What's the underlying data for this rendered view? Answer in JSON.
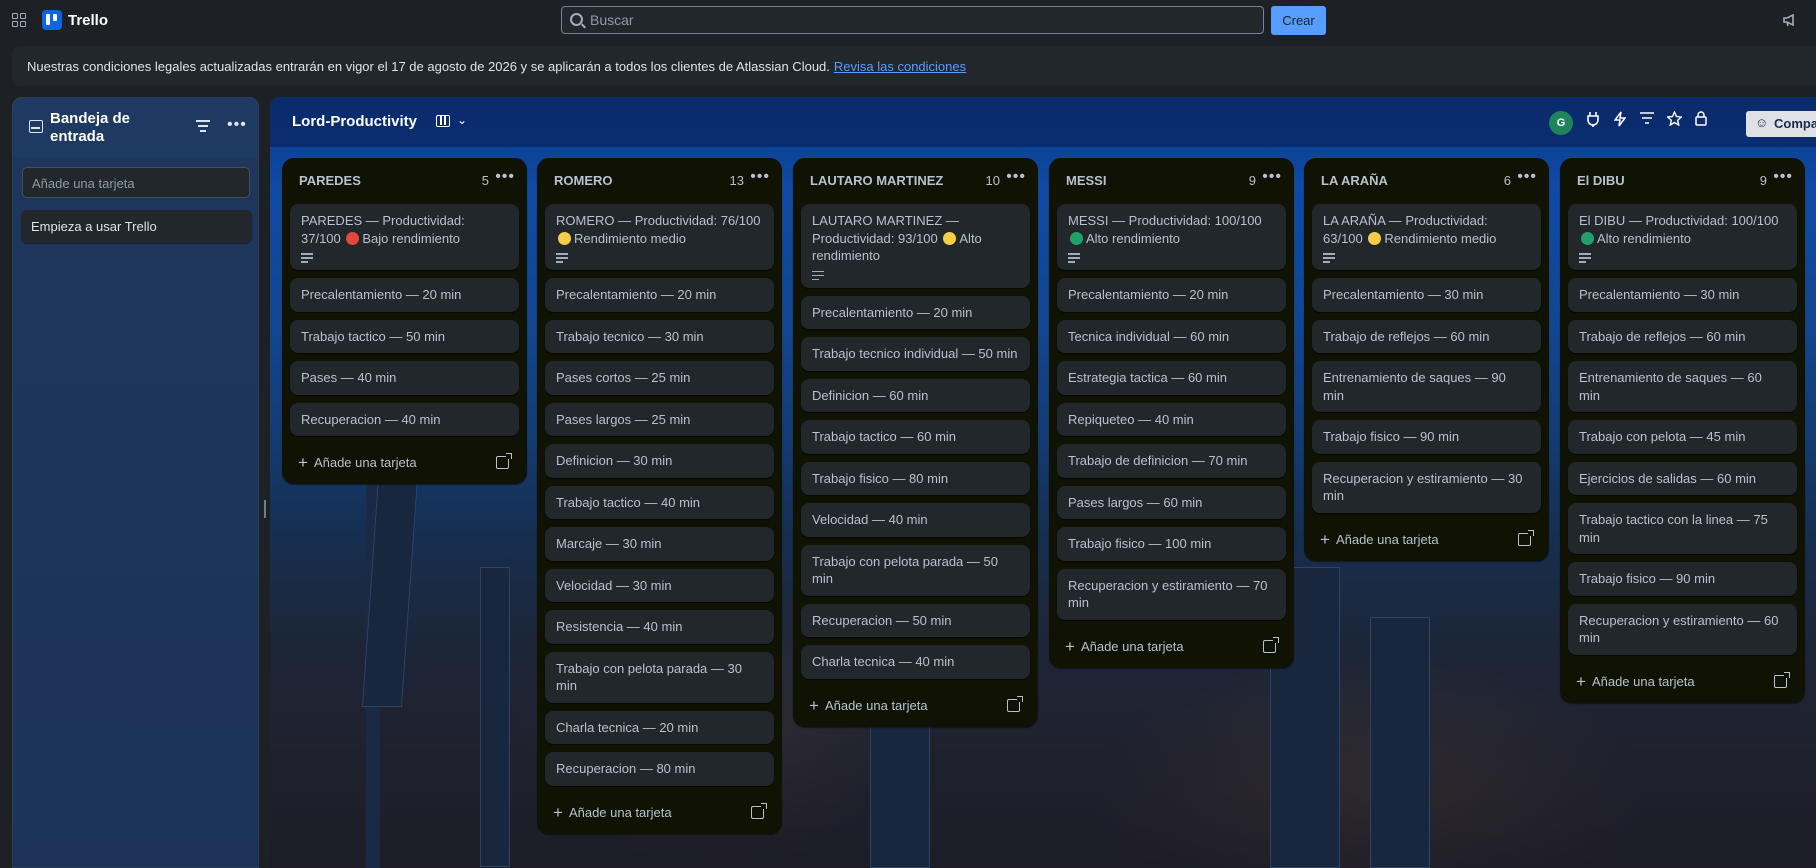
{
  "app": {
    "name": "Trello"
  },
  "search": {
    "placeholder": "Buscar"
  },
  "create_label": "Crear",
  "banner": {
    "text": "Nuestras condiciones legales actualizadas entrarán en vigor el 17 de agosto de 2026 y se aplicarán a todos los clientes de Atlassian Cloud.",
    "link": "Revisa las condiciones"
  },
  "inbox": {
    "title": "Bandeja de entrada",
    "add_placeholder": "Añade una tarjeta",
    "cards": [
      "Empieza a usar Trello"
    ]
  },
  "board": {
    "title": "Lord-Productivity",
    "member_initial": "G",
    "share_label": "Compa",
    "add_card_label": "Añade una tarjeta"
  },
  "status_colors": {
    "red": "#e2483d",
    "yellow": "#f5cd47",
    "green": "#22a06b"
  },
  "lists": [
    {
      "name": "PAREDES",
      "count": "5",
      "cards": [
        {
          "text": "PAREDES — Productividad: 37/100",
          "dot": "red",
          "status": "Bajo rendimiento",
          "desc": true
        },
        {
          "text": "Precalentamiento — 20 min"
        },
        {
          "text": "Trabajo tactico — 50 min"
        },
        {
          "text": "Pases — 40 min"
        },
        {
          "text": "Recuperacion — 40 min"
        }
      ]
    },
    {
      "name": "ROMERO",
      "count": "13",
      "cards": [
        {
          "text": "ROMERO — Productividad: 76/100",
          "dot": "yellow",
          "status": "Rendimiento medio",
          "desc": true
        },
        {
          "text": "Precalentamiento — 20 min"
        },
        {
          "text": "Trabajo tecnico — 30 min"
        },
        {
          "text": "Pases cortos — 25 min"
        },
        {
          "text": "Pases largos — 25 min"
        },
        {
          "text": "Definicion — 30 min"
        },
        {
          "text": "Trabajo tactico — 40 min"
        },
        {
          "text": "Marcaje — 30 min"
        },
        {
          "text": "Velocidad — 30 min"
        },
        {
          "text": "Resistencia — 40 min"
        },
        {
          "text": "Trabajo con pelota parada — 30 min"
        },
        {
          "text": "Charla tecnica — 20 min"
        },
        {
          "text": "Recuperacion — 80 min"
        }
      ]
    },
    {
      "name": "LAUTARO MARTINEZ",
      "count": "10",
      "cards": [
        {
          "text": "LAUTARO MARTINEZ — Productividad: 93/100",
          "dot": "yellow",
          "status": "Alto rendimiento",
          "desc": true
        },
        {
          "text": "Precalentamiento — 20 min"
        },
        {
          "text": "Trabajo tecnico individual — 50 min"
        },
        {
          "text": "Definicion — 60 min"
        },
        {
          "text": "Trabajo tactico — 60 min"
        },
        {
          "text": "Trabajo fisico — 80 min"
        },
        {
          "text": "Velocidad — 40 min"
        },
        {
          "text": "Trabajo con pelota parada — 50 min"
        },
        {
          "text": "Recuperacion — 50 min"
        },
        {
          "text": "Charla tecnica — 40 min"
        }
      ]
    },
    {
      "name": "MESSI",
      "count": "9",
      "cards": [
        {
          "text": "MESSI — Productividad: 100/100",
          "dot": "green",
          "status": "Alto rendimiento",
          "desc": true
        },
        {
          "text": "Precalentamiento — 20 min"
        },
        {
          "text": "Tecnica individual — 60 min"
        },
        {
          "text": "Estrategia tactica — 60 min"
        },
        {
          "text": "Repiqueteo — 40 min"
        },
        {
          "text": "Trabajo de definicion — 70 min"
        },
        {
          "text": "Pases largos — 60 min"
        },
        {
          "text": "Trabajo fisico — 100 min"
        },
        {
          "text": "Recuperacion y estiramiento — 70 min"
        }
      ]
    },
    {
      "name": "LA ARAÑA",
      "count": "6",
      "cards": [
        {
          "text": "LA ARAÑA — Productividad: 63/100",
          "dot": "yellow",
          "status": "Rendimiento medio",
          "desc": true
        },
        {
          "text": "Precalentamiento — 30 min"
        },
        {
          "text": "Trabajo de reflejos — 60 min"
        },
        {
          "text": "Entrenamiento de saques — 90 min"
        },
        {
          "text": "Trabajo fisico — 90 min"
        },
        {
          "text": "Recuperacion y estiramiento — 30 min"
        }
      ]
    },
    {
      "name": "El DIBU",
      "count": "9",
      "cards": [
        {
          "text": "El DIBU — Productividad: 100/100",
          "dot": "green",
          "status": "Alto rendimiento",
          "desc": true
        },
        {
          "text": "Precalentamiento — 30 min"
        },
        {
          "text": "Trabajo de reflejos — 60 min"
        },
        {
          "text": "Entrenamiento de saques — 60 min"
        },
        {
          "text": "Trabajo con pelota — 45 min"
        },
        {
          "text": "Ejercicios de salidas — 60 min"
        },
        {
          "text": "Trabajo tactico con la linea — 75 min"
        },
        {
          "text": "Trabajo fisico — 90 min"
        },
        {
          "text": "Recuperacion y estiramiento — 60 min"
        }
      ]
    }
  ]
}
